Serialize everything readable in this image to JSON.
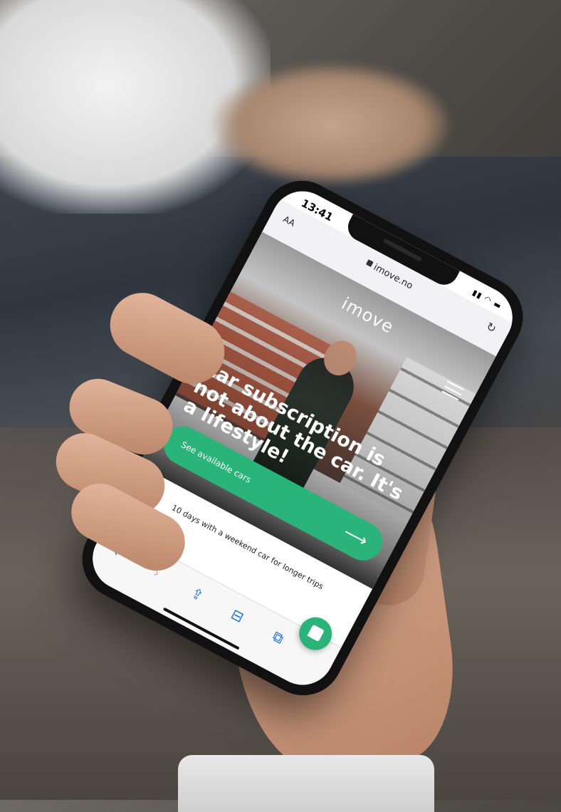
{
  "status": {
    "time": "13:41",
    "icons": "▮▮ ◠ ▬"
  },
  "browser": {
    "aa_label": "AA",
    "url": "imove.no"
  },
  "site": {
    "logo": "imove",
    "headline": "Car subscription is not about the car. It's a lifestyle!",
    "cta_label": "See available cars",
    "cta_arrow": "⟶",
    "feature_text": "10 days with a weekend car for longer trips"
  },
  "toolbar": {
    "back": "‹",
    "forward": "›",
    "share": "⇪",
    "bookmarks": "⊟",
    "tabs": "⧉"
  },
  "colors": {
    "accent": "#2ab47a",
    "link": "#1a73e8"
  }
}
